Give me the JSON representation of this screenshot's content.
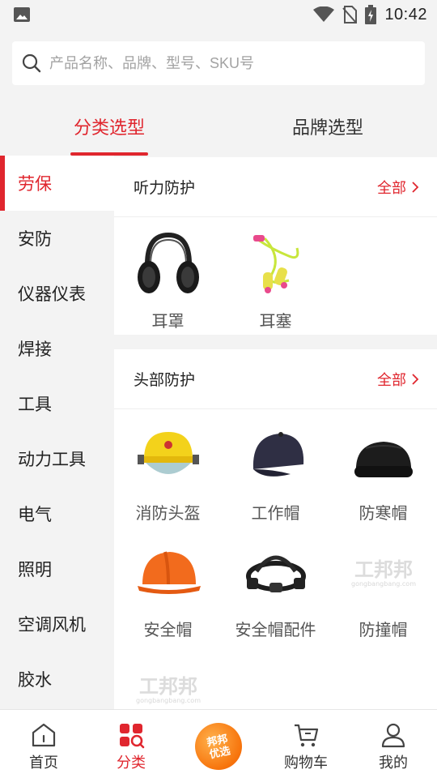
{
  "status_bar": {
    "time": "10:42",
    "colors": {
      "icon": "#555555"
    }
  },
  "search": {
    "placeholder": "产品名称、品牌、型号、SKU号"
  },
  "tabs": [
    {
      "label": "分类选型",
      "active": true
    },
    {
      "label": "品牌选型",
      "active": false
    }
  ],
  "sidebar": {
    "items": [
      {
        "label": "劳保",
        "active": true
      },
      {
        "label": "安防"
      },
      {
        "label": "仪器仪表"
      },
      {
        "label": "焊接"
      },
      {
        "label": "工具"
      },
      {
        "label": "动力工具"
      },
      {
        "label": "电气"
      },
      {
        "label": "照明"
      },
      {
        "label": "空调风机"
      },
      {
        "label": "胶水"
      }
    ]
  },
  "sections": [
    {
      "title": "听力防护",
      "all_label": "全部",
      "items": [
        {
          "label": "耳罩",
          "icon": "earmuff-image"
        },
        {
          "label": "耳塞",
          "icon": "earplug-image"
        }
      ]
    },
    {
      "title": "头部防护",
      "all_label": "全部",
      "items": [
        {
          "label": "消防头盔",
          "icon": "fire-helmet-image"
        },
        {
          "label": "工作帽",
          "icon": "work-cap-image"
        },
        {
          "label": "防寒帽",
          "icon": "winter-hat-image"
        },
        {
          "label": "安全帽",
          "icon": "hard-hat-image"
        },
        {
          "label": "安全帽配件",
          "icon": "hardhat-accessory-image"
        },
        {
          "label": "防撞帽",
          "icon": "placeholder-logo"
        },
        {
          "label": "",
          "icon": "placeholder-logo"
        }
      ]
    }
  ],
  "placeholder_logo": {
    "text": "工邦邦",
    "subtext": "gongbangbang.com"
  },
  "bottom_nav": {
    "items": [
      {
        "label": "首页",
        "icon": "home-icon"
      },
      {
        "label": "分类",
        "icon": "category-icon",
        "active": true
      },
      {
        "label": "购物车",
        "icon": "cart-icon"
      },
      {
        "label": "我的",
        "icon": "user-icon"
      }
    ],
    "center_badge": {
      "line1": "邦邦",
      "line2": "优选"
    }
  },
  "colors": {
    "accent": "#e0262e",
    "background": "#f3f3f3",
    "badge": "#f7740c"
  }
}
